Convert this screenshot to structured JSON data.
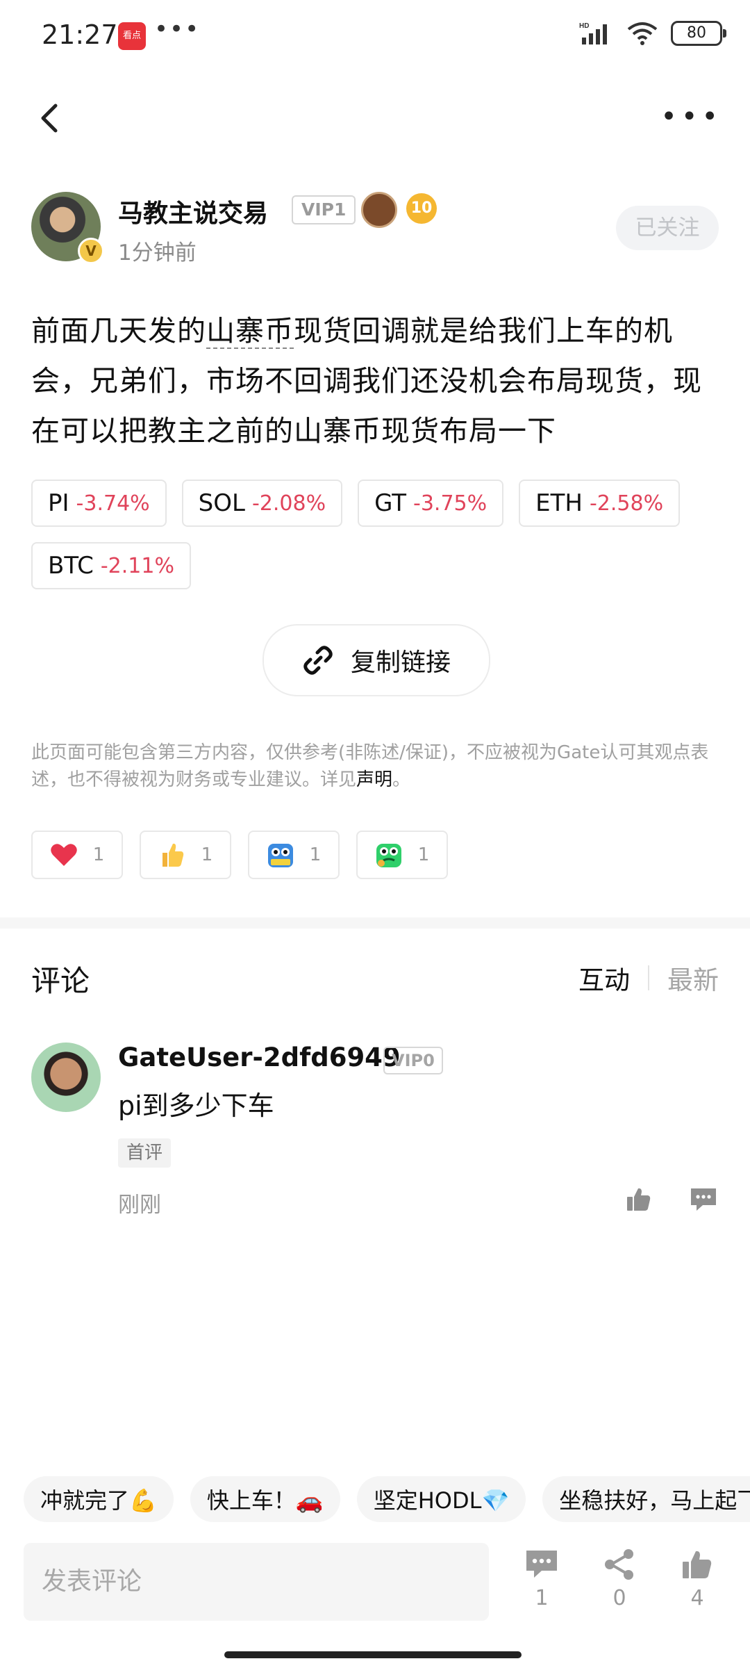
{
  "status_bar": {
    "time": "21:27",
    "app_icon_text": "看点",
    "dots": "•••",
    "network": "HD",
    "battery": "80"
  },
  "nav": {
    "back_icon": "chevron-left-icon",
    "more_icon": "more-horizontal-icon"
  },
  "author": {
    "name": "马教主说交易",
    "vip": "VIP1",
    "verified": "V",
    "level_medal": "10",
    "time": "1分钟前",
    "follow_label": "已关注"
  },
  "post": {
    "text_before": "前面几天发的",
    "text_highlight": "山寨币",
    "text_after": "现货回调就是给我们上车的机会，兄弟们，市场不回调我们还没机会布局现货，现在可以把教主之前的山寨币现货布局一下"
  },
  "coins": [
    {
      "symbol": "PI",
      "change": "-3.74%"
    },
    {
      "symbol": "SOL",
      "change": "-2.08%"
    },
    {
      "symbol": "GT",
      "change": "-3.75%"
    },
    {
      "symbol": "ETH",
      "change": "-2.58%"
    },
    {
      "symbol": "BTC",
      "change": "-2.11%"
    }
  ],
  "colors": {
    "negative": "#e0435a",
    "muted": "#a0a0a0"
  },
  "copy_link": {
    "label": "复制链接",
    "icon": "link-icon"
  },
  "disclaimer": {
    "text": "此页面可能包含第三方内容，仅供参考(非陈述/保证)，不应被视为Gate认可其观点表述，也不得被视为财务或专业建议。详见",
    "link": "声明",
    "end": "。"
  },
  "reactions": [
    {
      "icon": "heart-icon",
      "count": "1"
    },
    {
      "icon": "thumbs-up-emoji-icon",
      "count": "1"
    },
    {
      "icon": "hodl-owl-icon",
      "count": "1"
    },
    {
      "icon": "green-frog-icon",
      "count": "1"
    }
  ],
  "comments_section": {
    "title": "评论",
    "sort_active": "互动",
    "sort_inactive": "最新"
  },
  "comments": [
    {
      "user": "GateUser-2dfd6949",
      "vip": "VIP0",
      "text": "pi到多少下车",
      "tag": "首评",
      "time": "刚刚"
    }
  ],
  "quick_replies": [
    "冲就完了💪",
    "快上车！🚗",
    "坚定HODL💎",
    "坐稳扶好，马上起飞"
  ],
  "bottom_bar": {
    "input_placeholder": "发表评论",
    "comment_count": "1",
    "share_count": "0",
    "like_count": "4"
  }
}
